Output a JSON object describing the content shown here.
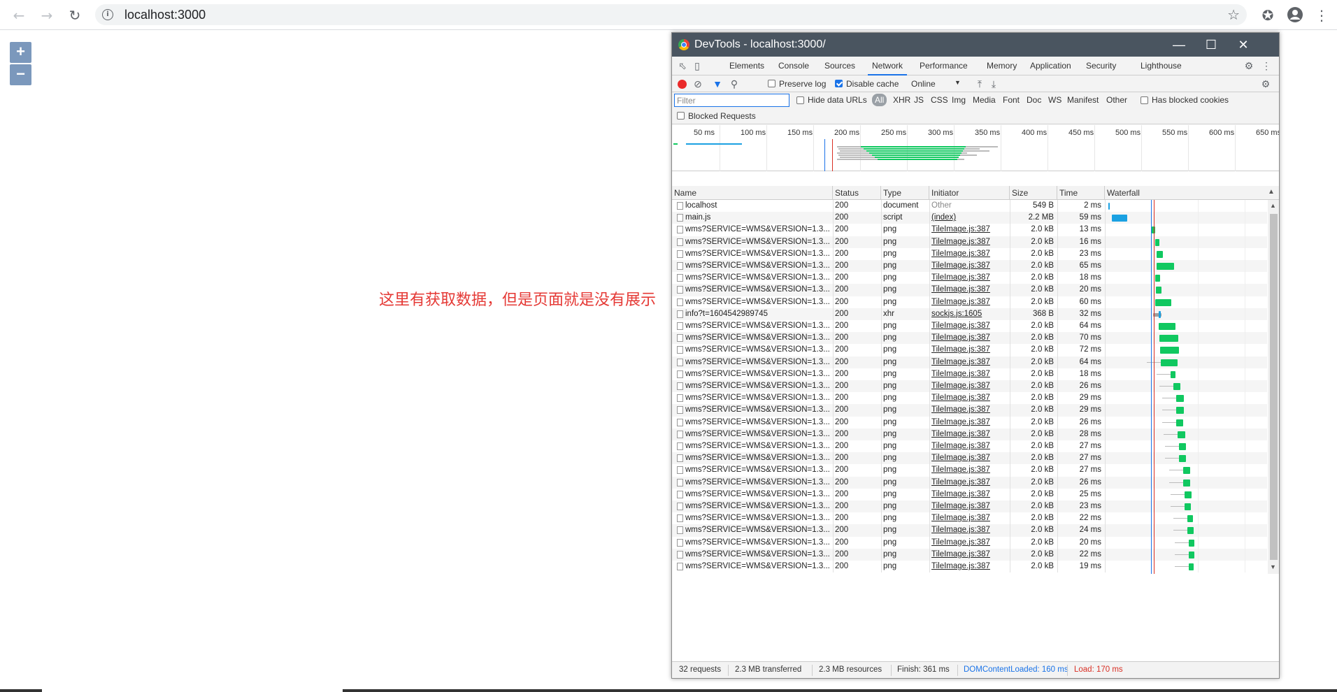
{
  "browser": {
    "url": "localhost:3000",
    "back_icon": "arrow-left-icon",
    "forward_icon": "arrow-right-icon",
    "reload_icon": "reload-icon"
  },
  "map": {
    "zoom_in": "+",
    "zoom_out": "−"
  },
  "annotation": "这里有获取数据，但是页面就是没有展示",
  "devtools": {
    "title": "DevTools - localhost:3000/",
    "tabs": [
      "Elements",
      "Console",
      "Sources",
      "Network",
      "Performance",
      "Memory",
      "Application",
      "Security",
      "Lighthouse"
    ],
    "active_tab": "Network",
    "toolbar": {
      "preserve_log": "Preserve log",
      "preserve_log_checked": false,
      "disable_cache": "Disable cache",
      "disable_cache_checked": true,
      "throttle": "Online"
    },
    "filter": {
      "placeholder": "Filter",
      "hide_data_urls": "Hide data URLs",
      "types": [
        "All",
        "XHR",
        "JS",
        "CSS",
        "Img",
        "Media",
        "Font",
        "Doc",
        "WS",
        "Manifest",
        "Other"
      ],
      "has_blocked_cookies": "Has blocked cookies",
      "blocked_requests": "Blocked Requests"
    },
    "overview_ticks": [
      "50 ms",
      "100 ms",
      "150 ms",
      "200 ms",
      "250 ms",
      "300 ms",
      "350 ms",
      "400 ms",
      "450 ms",
      "500 ms",
      "550 ms",
      "600 ms",
      "650 ms"
    ],
    "columns": [
      "Name",
      "Status",
      "Type",
      "Initiator",
      "Size",
      "Time",
      "Waterfall"
    ],
    "rows": [
      {
        "name": "localhost",
        "status": "200",
        "type": "document",
        "initiator": "Other",
        "size": "549 B",
        "time": "2 ms"
      },
      {
        "name": "main.js",
        "status": "200",
        "type": "script",
        "initiator": "(index)",
        "size": "2.2 MB",
        "time": "59 ms"
      },
      {
        "name": "wms?SERVICE=WMS&VERSION=1.3...",
        "status": "200",
        "type": "png",
        "initiator": "TileImage.js:387",
        "size": "2.0 kB",
        "time": "13 ms"
      },
      {
        "name": "wms?SERVICE=WMS&VERSION=1.3...",
        "status": "200",
        "type": "png",
        "initiator": "TileImage.js:387",
        "size": "2.0 kB",
        "time": "16 ms"
      },
      {
        "name": "wms?SERVICE=WMS&VERSION=1.3...",
        "status": "200",
        "type": "png",
        "initiator": "TileImage.js:387",
        "size": "2.0 kB",
        "time": "23 ms"
      },
      {
        "name": "wms?SERVICE=WMS&VERSION=1.3...",
        "status": "200",
        "type": "png",
        "initiator": "TileImage.js:387",
        "size": "2.0 kB",
        "time": "65 ms"
      },
      {
        "name": "wms?SERVICE=WMS&VERSION=1.3...",
        "status": "200",
        "type": "png",
        "initiator": "TileImage.js:387",
        "size": "2.0 kB",
        "time": "18 ms"
      },
      {
        "name": "wms?SERVICE=WMS&VERSION=1.3...",
        "status": "200",
        "type": "png",
        "initiator": "TileImage.js:387",
        "size": "2.0 kB",
        "time": "20 ms"
      },
      {
        "name": "wms?SERVICE=WMS&VERSION=1.3...",
        "status": "200",
        "type": "png",
        "initiator": "TileImage.js:387",
        "size": "2.0 kB",
        "time": "60 ms"
      },
      {
        "name": "info?t=1604542989745",
        "status": "200",
        "type": "xhr",
        "initiator": "sockjs.js:1605",
        "size": "368 B",
        "time": "32 ms"
      },
      {
        "name": "wms?SERVICE=WMS&VERSION=1.3...",
        "status": "200",
        "type": "png",
        "initiator": "TileImage.js:387",
        "size": "2.0 kB",
        "time": "64 ms"
      },
      {
        "name": "wms?SERVICE=WMS&VERSION=1.3...",
        "status": "200",
        "type": "png",
        "initiator": "TileImage.js:387",
        "size": "2.0 kB",
        "time": "70 ms"
      },
      {
        "name": "wms?SERVICE=WMS&VERSION=1.3...",
        "status": "200",
        "type": "png",
        "initiator": "TileImage.js:387",
        "size": "2.0 kB",
        "time": "72 ms"
      },
      {
        "name": "wms?SERVICE=WMS&VERSION=1.3...",
        "status": "200",
        "type": "png",
        "initiator": "TileImage.js:387",
        "size": "2.0 kB",
        "time": "64 ms"
      },
      {
        "name": "wms?SERVICE=WMS&VERSION=1.3...",
        "status": "200",
        "type": "png",
        "initiator": "TileImage.js:387",
        "size": "2.0 kB",
        "time": "18 ms"
      },
      {
        "name": "wms?SERVICE=WMS&VERSION=1.3...",
        "status": "200",
        "type": "png",
        "initiator": "TileImage.js:387",
        "size": "2.0 kB",
        "time": "26 ms"
      },
      {
        "name": "wms?SERVICE=WMS&VERSION=1.3...",
        "status": "200",
        "type": "png",
        "initiator": "TileImage.js:387",
        "size": "2.0 kB",
        "time": "29 ms"
      },
      {
        "name": "wms?SERVICE=WMS&VERSION=1.3...",
        "status": "200",
        "type": "png",
        "initiator": "TileImage.js:387",
        "size": "2.0 kB",
        "time": "29 ms"
      },
      {
        "name": "wms?SERVICE=WMS&VERSION=1.3...",
        "status": "200",
        "type": "png",
        "initiator": "TileImage.js:387",
        "size": "2.0 kB",
        "time": "26 ms"
      },
      {
        "name": "wms?SERVICE=WMS&VERSION=1.3...",
        "status": "200",
        "type": "png",
        "initiator": "TileImage.js:387",
        "size": "2.0 kB",
        "time": "28 ms"
      },
      {
        "name": "wms?SERVICE=WMS&VERSION=1.3...",
        "status": "200",
        "type": "png",
        "initiator": "TileImage.js:387",
        "size": "2.0 kB",
        "time": "27 ms"
      },
      {
        "name": "wms?SERVICE=WMS&VERSION=1.3...",
        "status": "200",
        "type": "png",
        "initiator": "TileImage.js:387",
        "size": "2.0 kB",
        "time": "27 ms"
      },
      {
        "name": "wms?SERVICE=WMS&VERSION=1.3...",
        "status": "200",
        "type": "png",
        "initiator": "TileImage.js:387",
        "size": "2.0 kB",
        "time": "27 ms"
      },
      {
        "name": "wms?SERVICE=WMS&VERSION=1.3...",
        "status": "200",
        "type": "png",
        "initiator": "TileImage.js:387",
        "size": "2.0 kB",
        "time": "26 ms"
      },
      {
        "name": "wms?SERVICE=WMS&VERSION=1.3...",
        "status": "200",
        "type": "png",
        "initiator": "TileImage.js:387",
        "size": "2.0 kB",
        "time": "25 ms"
      },
      {
        "name": "wms?SERVICE=WMS&VERSION=1.3...",
        "status": "200",
        "type": "png",
        "initiator": "TileImage.js:387",
        "size": "2.0 kB",
        "time": "23 ms"
      },
      {
        "name": "wms?SERVICE=WMS&VERSION=1.3...",
        "status": "200",
        "type": "png",
        "initiator": "TileImage.js:387",
        "size": "2.0 kB",
        "time": "22 ms"
      },
      {
        "name": "wms?SERVICE=WMS&VERSION=1.3...",
        "status": "200",
        "type": "png",
        "initiator": "TileImage.js:387",
        "size": "2.0 kB",
        "time": "24 ms"
      },
      {
        "name": "wms?SERVICE=WMS&VERSION=1.3...",
        "status": "200",
        "type": "png",
        "initiator": "TileImage.js:387",
        "size": "2.0 kB",
        "time": "20 ms"
      },
      {
        "name": "wms?SERVICE=WMS&VERSION=1.3...",
        "status": "200",
        "type": "png",
        "initiator": "TileImage.js:387",
        "size": "2.0 kB",
        "time": "22 ms"
      },
      {
        "name": "wms?SERVICE=WMS&VERSION=1.3...",
        "status": "200",
        "type": "png",
        "initiator": "TileImage.js:387",
        "size": "2.0 kB",
        "time": "19 ms"
      }
    ],
    "status_bar": {
      "requests": "32 requests",
      "transferred": "2.3 MB transferred",
      "resources": "2.3 MB resources",
      "finish": "Finish: 361 ms",
      "dom_content_loaded": "DOMContentLoaded: 160 ms",
      "load": "Load: 170 ms"
    },
    "colors": {
      "dcl": "#1a73e8",
      "load": "#d93025",
      "png_bar": "#10c860",
      "script_bar": "#1ba1e2"
    }
  }
}
